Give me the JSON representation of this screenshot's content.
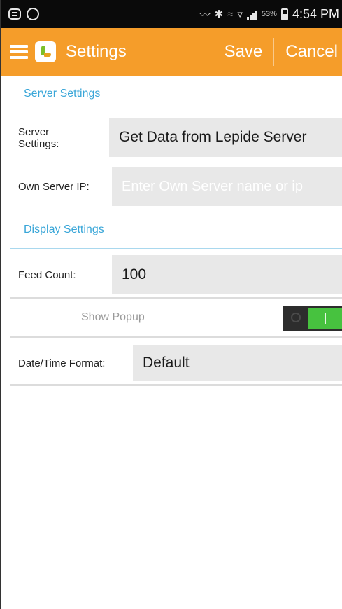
{
  "status_bar": {
    "icons": [
      "message-icon",
      "whatsapp-icon",
      "vibrate-icon",
      "bluetooth-icon",
      "nfc-icon",
      "wifi-icon",
      "signal-icon",
      "battery-icon"
    ],
    "battery": "53%",
    "time": "4:54 PM"
  },
  "action_bar": {
    "title": "Settings",
    "save_label": "Save",
    "cancel_label": "Cancel",
    "color": "#f59d2a"
  },
  "server_section": {
    "header": "Server Settings",
    "server_settings_label": "Server Settings:",
    "server_settings_value": "Get Data from Lepide Server",
    "own_server_ip_label": "Own Server IP:",
    "own_server_ip_placeholder": "Enter Own Server name or ip"
  },
  "display_section": {
    "header": "Display Settings",
    "feed_count_label": "Feed Count:",
    "feed_count_value": "100",
    "show_popup_label": "Show Popup",
    "show_popup_on": true,
    "datetime_label": "Date/Time Format:",
    "datetime_value": "Default"
  },
  "colors": {
    "accent_blue": "#39a6d8",
    "toggle_on": "#47c23f"
  }
}
